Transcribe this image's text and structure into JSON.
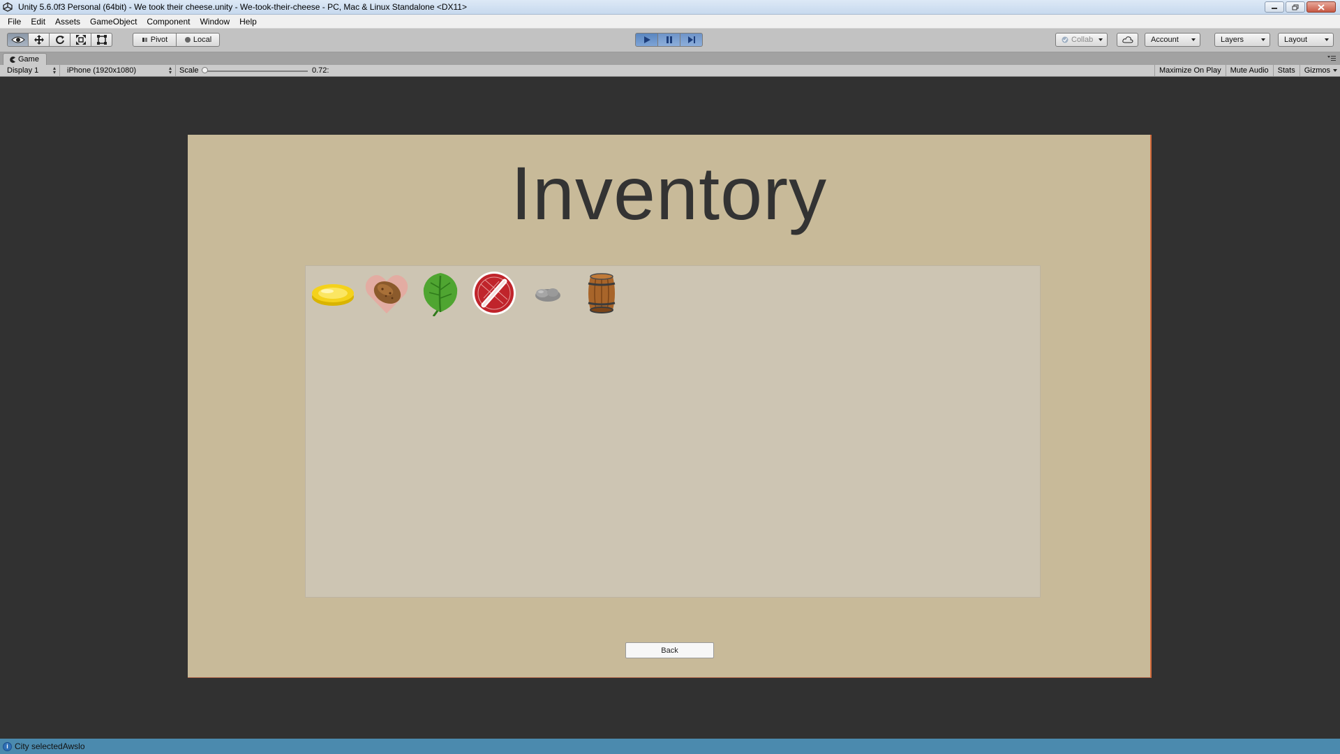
{
  "window": {
    "title": "Unity 5.6.0f3 Personal (64bit) - We took their cheese.unity - We-took-their-cheese - PC, Mac & Linux Standalone <DX11>"
  },
  "menu": [
    "File",
    "Edit",
    "Assets",
    "GameObject",
    "Component",
    "Window",
    "Help"
  ],
  "toolbar": {
    "pivot_label": "Pivot",
    "local_label": "Local",
    "collab_label": "Collab",
    "account_label": "Account",
    "layers_label": "Layers",
    "layout_label": "Layout",
    "play_state": "playing",
    "active_tool": "view-tool"
  },
  "game_tab": {
    "label": "Game"
  },
  "game_view": {
    "display": "Display 1",
    "resolution": "iPhone (1920x1080)",
    "scale_label": "Scale",
    "scale_value": "0.72:",
    "maximize_on_play": "Maximize On Play",
    "mute_audio": "Mute Audio",
    "stats": "Stats",
    "gizmos": "Gizmos"
  },
  "game": {
    "background_color": "#c8ba99",
    "title": "Inventory",
    "items": [
      {
        "icon": "gold-coin-icon"
      },
      {
        "icon": "potato-heart-icon"
      },
      {
        "icon": "green-leaf-icon"
      },
      {
        "icon": "red-scroll-seal-icon"
      },
      {
        "icon": "grey-stone-icon"
      },
      {
        "icon": "wooden-barrel-icon"
      }
    ],
    "back_button": "Back"
  },
  "status": {
    "message": "City selectedAwslo"
  }
}
